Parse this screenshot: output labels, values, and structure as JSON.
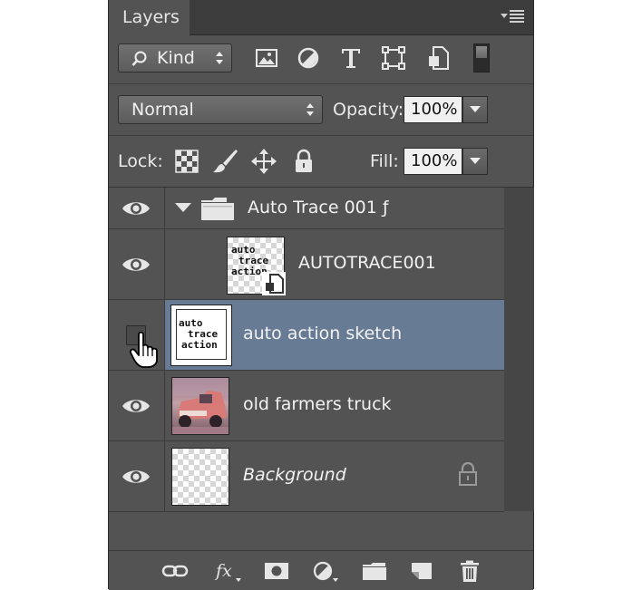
{
  "panel": {
    "tab_label": "Layers"
  },
  "filter": {
    "kind_label": "Kind"
  },
  "blend": {
    "mode": "Normal",
    "opacity_label": "Opacity:",
    "opacity_value": "100%"
  },
  "lock": {
    "label": "Lock:",
    "fill_label": "Fill:",
    "fill_value": "100%"
  },
  "layers": [
    {
      "name": "Auto Trace 001 ƒ",
      "type": "group",
      "visible": true
    },
    {
      "name": "AUTOTRACE001",
      "type": "smart-object",
      "visible": true,
      "thumb_text": [
        "auto",
        "trace",
        "action"
      ]
    },
    {
      "name": "auto action sketch",
      "type": "layer",
      "visible": false,
      "selected": true,
      "thumb_text": [
        "auto",
        "trace",
        "action"
      ]
    },
    {
      "name": "old farmers truck",
      "type": "layer",
      "visible": true
    },
    {
      "name": "Background",
      "type": "background",
      "visible": true,
      "locked": true
    }
  ],
  "colors": {
    "panel_bg": "#535353",
    "selected_row": "#687b95",
    "tab_bar": "#3c3c3c"
  }
}
